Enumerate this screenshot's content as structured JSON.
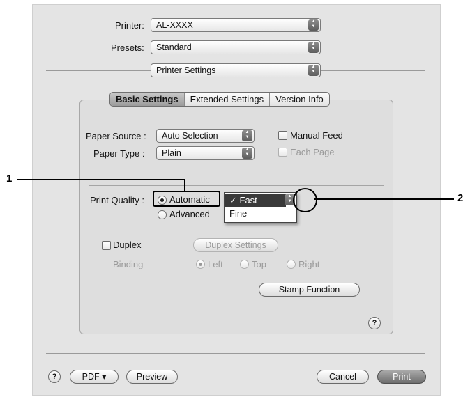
{
  "header": {
    "printer_label": "Printer:",
    "printer_value": "AL-XXXX",
    "presets_label": "Presets:",
    "presets_value": "Standard",
    "panel_value": "Printer Settings"
  },
  "tabs": [
    {
      "label": "Basic Settings",
      "selected": true
    },
    {
      "label": "Extended Settings",
      "selected": false
    },
    {
      "label": "Version Info",
      "selected": false
    }
  ],
  "paper": {
    "source_label": "Paper Source :",
    "source_value": "Auto Selection",
    "type_label": "Paper Type :",
    "type_value": "Plain",
    "manual_feed_label": "Manual Feed",
    "each_page_label": "Each Page"
  },
  "quality": {
    "label": "Print Quality :",
    "automatic_label": "Automatic",
    "advanced_label": "Advanced",
    "menu_items": [
      "✓ Fast",
      "Fine"
    ]
  },
  "duplex": {
    "duplex_label": "Duplex",
    "settings_button": "Duplex Settings",
    "binding_label": "Binding",
    "left_label": "Left",
    "top_label": "Top",
    "right_label": "Right"
  },
  "stamp_button": "Stamp Function",
  "help_label": "?",
  "footer": {
    "help_label": "?",
    "pdf_label": "PDF ▾",
    "preview_label": "Preview",
    "cancel_label": "Cancel",
    "print_label": "Print"
  },
  "callouts": [
    "1",
    "2"
  ]
}
